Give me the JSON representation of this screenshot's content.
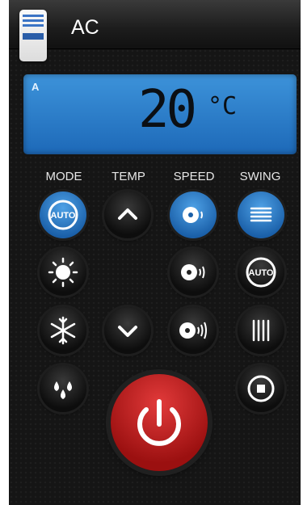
{
  "header": {
    "title": "AC"
  },
  "display": {
    "temperature": "20",
    "unit": "°C",
    "mode_indicator": "A"
  },
  "labels": {
    "mode": "MODE",
    "temp": "TEMP",
    "speed": "SPEED",
    "swing": "SWING"
  },
  "buttons": {
    "mode_auto": "AUTO",
    "swing_auto": "AUTO"
  },
  "colors": {
    "accent_blue": "#1d69b8",
    "power_red": "#c41e1e",
    "background": "#151515"
  },
  "icons": {
    "mode": [
      "auto-icon",
      "sun-icon",
      "snowflake-icon",
      "water-drops-icon"
    ],
    "temp": [
      "chevron-up-icon",
      "chevron-down-icon"
    ],
    "speed": [
      "fan-low-icon",
      "fan-medium-icon",
      "fan-high-icon"
    ],
    "swing": [
      "swing-horizontal-icon",
      "auto-icon",
      "swing-vertical-icon",
      "swing-stop-icon"
    ],
    "power": "power-icon"
  }
}
